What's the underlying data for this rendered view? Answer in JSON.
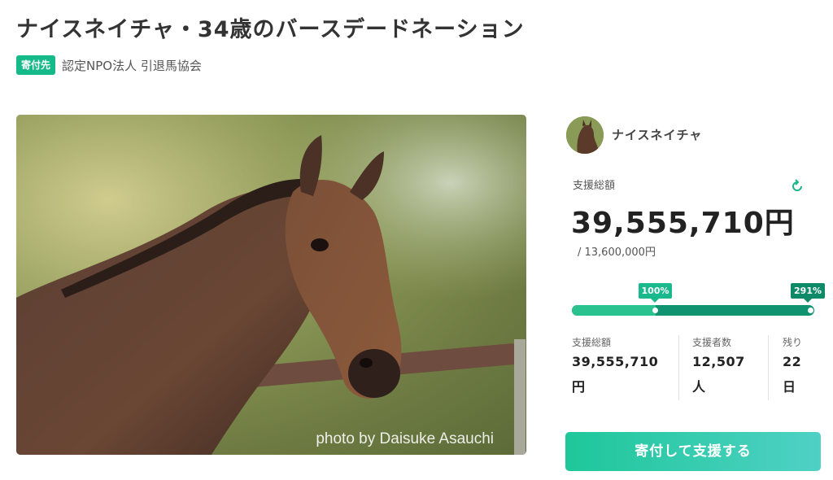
{
  "page": {
    "title": "ナイスネイチャ・34歳のバースデードネーション",
    "badge": "寄付先",
    "organization": "認定NPO法人 引退馬協会"
  },
  "hero": {
    "credit": "photo by Daisuke Asauchi"
  },
  "sidebar": {
    "name": "ナイスネイチャ",
    "total_label": "支援総額",
    "total_amount": "39,555,710円",
    "goal": "/ 13,600,000円",
    "progress": {
      "milestone_label": "100%",
      "current_label": "291%",
      "milestone_fraction": 0.344,
      "current_fraction": 1.0
    },
    "stats": [
      {
        "label": "支援総額",
        "value": "39,555,710",
        "unit": "円"
      },
      {
        "label": "支援者数",
        "value": "12,507",
        "unit": "人"
      },
      {
        "label": "残り",
        "value": "22",
        "unit": "日"
      }
    ],
    "cta_label": "寄付して支援する"
  },
  "colors": {
    "accent": "#16b98a",
    "progress_dark": "#0f9371",
    "progress_light": "#2ac28f"
  },
  "icons": {
    "refresh": "refresh-icon"
  }
}
